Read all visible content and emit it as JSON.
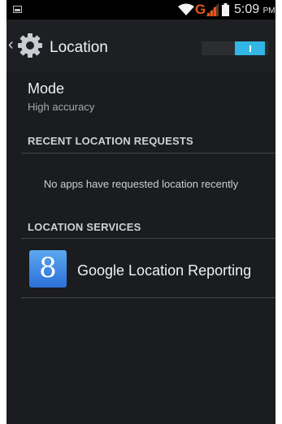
{
  "status_bar": {
    "network_type": "G",
    "time": "5:09",
    "ampm": "PM",
    "icons": [
      "notification-icon",
      "wifi-icon",
      "signal-icon",
      "battery-icon"
    ]
  },
  "action_bar": {
    "title": "Location",
    "back_icon": "chevron-left-icon",
    "app_icon": "gear-icon",
    "master_switch": {
      "state": "on",
      "accent_color": "#33b5e5"
    }
  },
  "mode": {
    "title": "Mode",
    "value": "High accuracy"
  },
  "recent_requests": {
    "header": "RECENT LOCATION REQUESTS",
    "empty_message": "No apps have requested location recently"
  },
  "location_services": {
    "header": "LOCATION SERVICES",
    "items": [
      {
        "label": "Google Location Reporting",
        "icon": "google-icon",
        "glyph": "8"
      }
    ]
  }
}
